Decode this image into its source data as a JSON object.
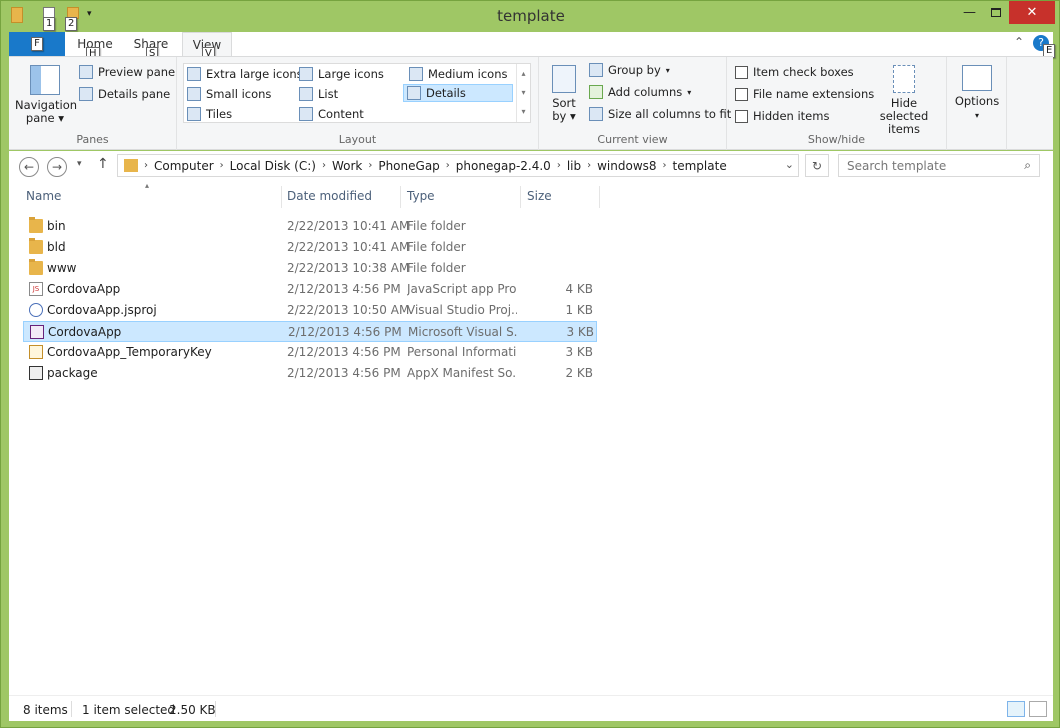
{
  "window": {
    "title": "template",
    "min_icon": "minimize-icon",
    "max_icon": "maximize-icon",
    "close_icon": "close-icon"
  },
  "qat": {
    "keytips": [
      "1",
      "2"
    ]
  },
  "tabs": {
    "file": "F",
    "home": "Home",
    "share": "Share",
    "view": "View",
    "keytips": {
      "home": "H",
      "share": "S",
      "view": "V",
      "help": "E"
    }
  },
  "ribbon": {
    "panes": {
      "label": "Panes",
      "navigation_pane": "Navigation\npane",
      "preview_pane": "Preview pane",
      "details_pane": "Details pane"
    },
    "layout": {
      "label": "Layout",
      "items": [
        "Extra large icons",
        "Large icons",
        "Medium icons",
        "Small icons",
        "List",
        "Details",
        "Tiles",
        "Content"
      ],
      "selected": "Details"
    },
    "current_view": {
      "label": "Current view",
      "sort_by": "Sort\nby",
      "group_by": "Group by",
      "add_columns": "Add columns",
      "size_all": "Size all columns to fit"
    },
    "show_hide": {
      "label": "Show/hide",
      "item_check_boxes": "Item check boxes",
      "file_name_extensions": "File name extensions",
      "hidden_items": "Hidden items",
      "hide_selected": "Hide selected\nitems"
    },
    "options": "Options"
  },
  "address": {
    "path": [
      "Computer",
      "Local Disk (C:)",
      "Work",
      "PhoneGap",
      "phonegap-2.4.0",
      "lib",
      "windows8",
      "template"
    ],
    "search_placeholder": "Search template"
  },
  "columns": {
    "name": "Name",
    "date": "Date modified",
    "type": "Type",
    "size": "Size"
  },
  "files": [
    {
      "name": "bin",
      "date": "2/22/2013 10:41 AM",
      "type": "File folder",
      "size": "",
      "icon": "folder-icon"
    },
    {
      "name": "bld",
      "date": "2/22/2013 10:41 AM",
      "type": "File folder",
      "size": "",
      "icon": "folder-icon"
    },
    {
      "name": "www",
      "date": "2/22/2013 10:38 AM",
      "type": "File folder",
      "size": "",
      "icon": "folder-icon"
    },
    {
      "name": "CordovaApp",
      "date": "2/12/2013 4:56 PM",
      "type": "JavaScript app Pro...",
      "size": "4 KB",
      "icon": "js-project-icon"
    },
    {
      "name": "CordovaApp.jsproj",
      "date": "2/22/2013 10:50 AM",
      "type": "Visual Studio Proj...",
      "size": "1 KB",
      "icon": "vs-project-icon"
    },
    {
      "name": "CordovaApp",
      "date": "2/12/2013 4:56 PM",
      "type": "Microsoft Visual S...",
      "size": "3 KB",
      "icon": "vs-solution-icon",
      "selected": true
    },
    {
      "name": "CordovaApp_TemporaryKey",
      "date": "2/12/2013 4:56 PM",
      "type": "Personal Informati...",
      "size": "3 KB",
      "icon": "certificate-icon"
    },
    {
      "name": "package",
      "date": "2/12/2013 4:56 PM",
      "type": "AppX Manifest So...",
      "size": "2 KB",
      "icon": "manifest-icon"
    }
  ],
  "status": {
    "items": "8 items",
    "selected": "1 item selected",
    "size": "2.50 KB"
  }
}
